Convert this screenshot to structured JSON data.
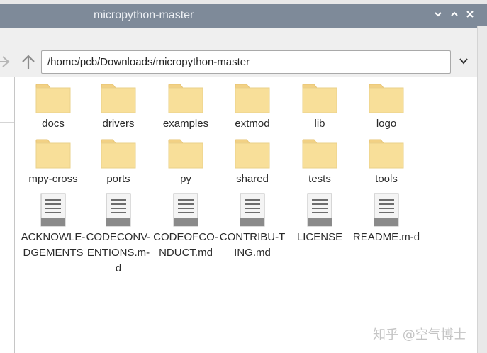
{
  "window": {
    "title": "micropython-master"
  },
  "toolbar": {
    "path": "/home/pcb/Downloads/micropython-master"
  },
  "folders": [
    {
      "label": "docs"
    },
    {
      "label": "drivers"
    },
    {
      "label": "examples"
    },
    {
      "label": "extmod"
    },
    {
      "label": "lib"
    },
    {
      "label": "logo"
    },
    {
      "label": "mpy-cross"
    },
    {
      "label": "ports"
    },
    {
      "label": "py"
    },
    {
      "label": "shared"
    },
    {
      "label": "tests"
    },
    {
      "label": "tools"
    }
  ],
  "files": [
    {
      "label": "ACKNOWLE-DGEMENTS"
    },
    {
      "label": "CODECONV-ENTIONS.m-d"
    },
    {
      "label": "CODEOFCO-NDUCT.md"
    },
    {
      "label": "CONTRIBU-TING.md"
    },
    {
      "label": "LICENSE"
    },
    {
      "label": "README.m-d"
    }
  ],
  "watermark": "知乎 @空气博士",
  "colors": {
    "titlebar": "#7e8a99",
    "folder_body": "#f8df99",
    "folder_tab": "#f2d184",
    "toolbar": "#efefef"
  }
}
